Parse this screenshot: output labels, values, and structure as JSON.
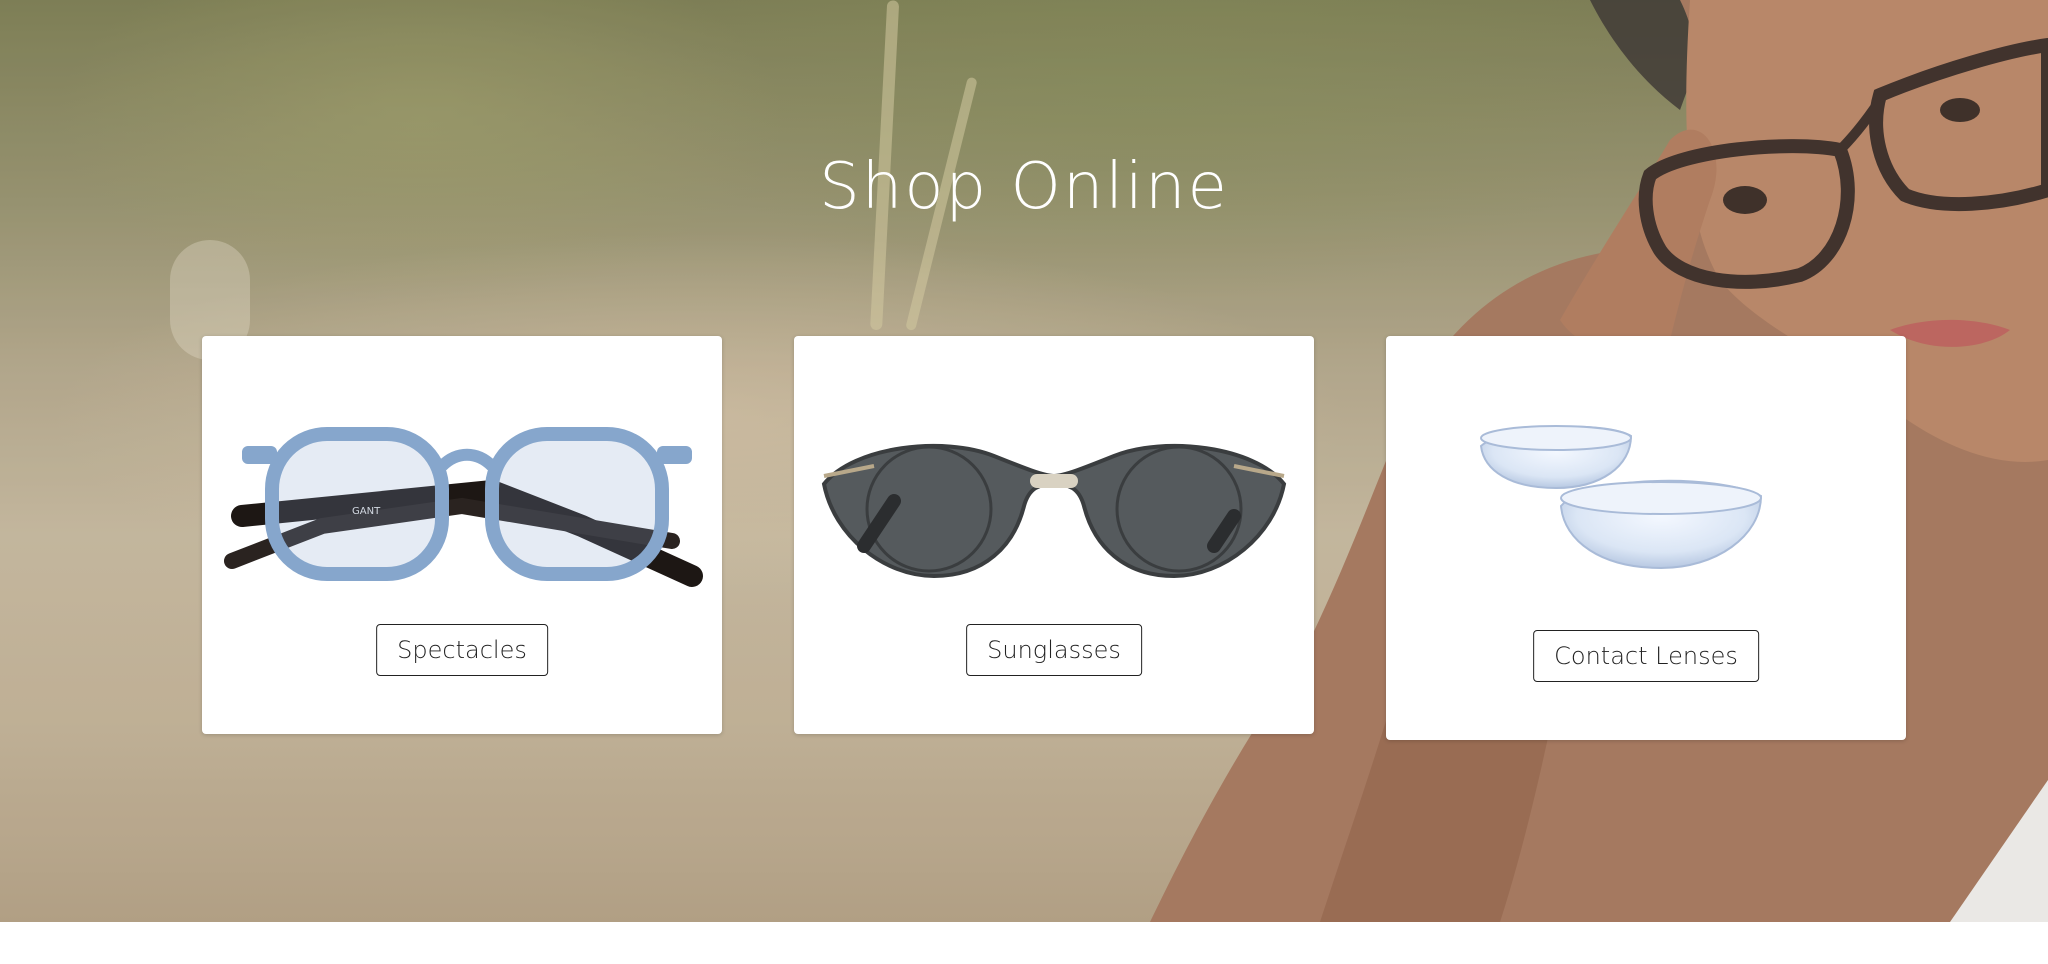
{
  "hero": {
    "title": "Shop Online"
  },
  "categories": [
    {
      "label": "Spectacles",
      "image": "blue-spectacles-icon"
    },
    {
      "label": "Sunglasses",
      "image": "grey-sunglasses-icon"
    },
    {
      "label": "Contact Lenses",
      "image": "contact-lenses-icon"
    }
  ],
  "spectacles_art": {
    "temple_text": "GANT"
  }
}
